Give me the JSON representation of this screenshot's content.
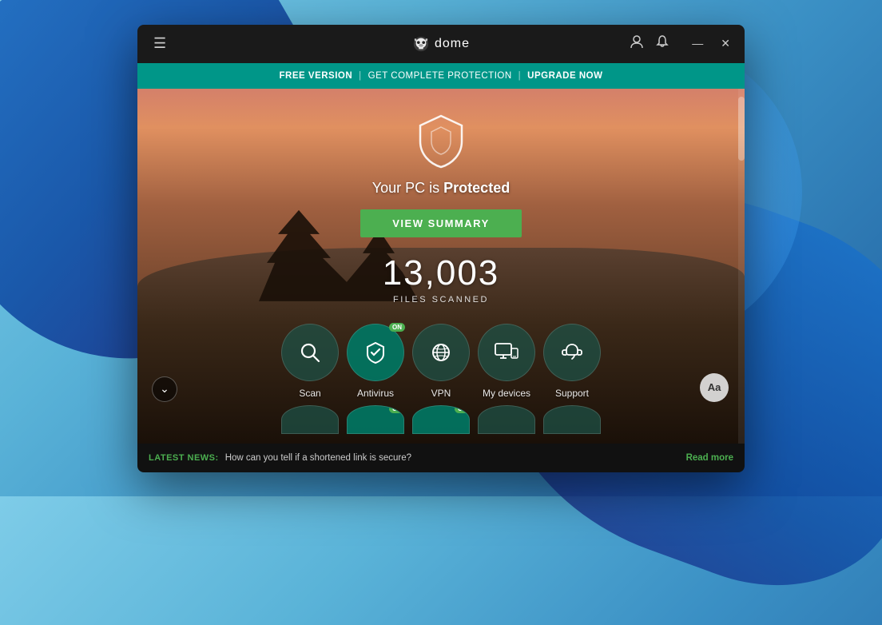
{
  "window": {
    "title": "Panda Dome",
    "logo_text": "dome"
  },
  "titlebar": {
    "hamburger": "☰",
    "user_icon": "👤",
    "bell_icon": "🔔",
    "minimize": "—",
    "close": "✕"
  },
  "banner": {
    "free_version": "FREE VERSION",
    "separator1": "|",
    "get_protection": "GET COMPLETE PROTECTION",
    "separator2": "|",
    "upgrade": "UPGRADE NOW"
  },
  "status": {
    "prefix": "Your PC is ",
    "state": "Protected"
  },
  "view_summary_btn": "VIEW SUMMARY",
  "files_scanned": {
    "count": "13,003",
    "label": "FILES SCANNED"
  },
  "features": [
    {
      "id": "scan",
      "icon": "🔍",
      "label": "Scan",
      "active": false,
      "on": false
    },
    {
      "id": "antivirus",
      "icon": "🛡",
      "label": "Antivirus",
      "active": true,
      "on": true
    },
    {
      "id": "vpn",
      "icon": "🌐",
      "label": "VPN",
      "active": false,
      "on": false
    },
    {
      "id": "my-devices",
      "icon": "💻",
      "label": "My devices",
      "active": false,
      "on": false
    },
    {
      "id": "support",
      "icon": "🎧",
      "label": "Support",
      "active": false,
      "on": false
    }
  ],
  "features_row2": [
    {
      "id": "feat2-1",
      "on": false
    },
    {
      "id": "feat2-2",
      "on": true
    },
    {
      "id": "feat2-3",
      "on": true
    },
    {
      "id": "feat2-4",
      "on": false
    },
    {
      "id": "feat2-5",
      "on": false
    }
  ],
  "on_badge": "ON",
  "expand_btn": "⌄",
  "aa_btn": "Aa",
  "news": {
    "label": "LATEST NEWS:",
    "text": "How can you tell if a shortened link is secure?",
    "link": "Read more"
  }
}
